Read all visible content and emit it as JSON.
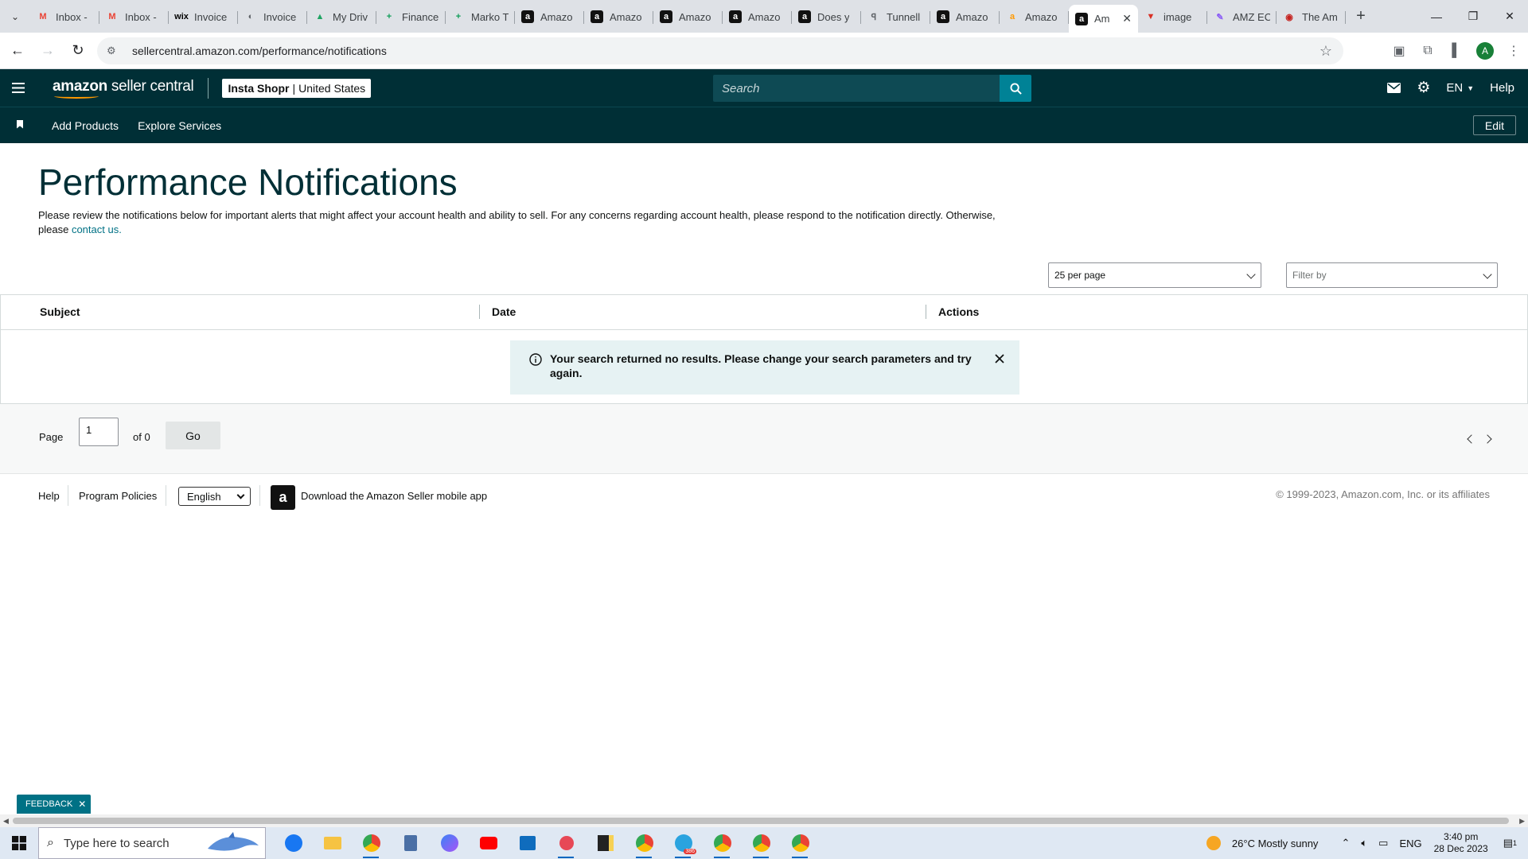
{
  "browser": {
    "tabs": [
      {
        "label": "Inbox -",
        "icon": "gmail-icon",
        "color": "#ea4335",
        "glyph": "M"
      },
      {
        "label": "Inbox -",
        "icon": "gmail-icon",
        "color": "#ea4335",
        "glyph": "M"
      },
      {
        "label": "Invoice",
        "icon": "wix-icon",
        "color": "#000000",
        "glyph": "wix"
      },
      {
        "label": "Invoice",
        "icon": "globe-icon",
        "color": "#5f6368",
        "glyph": "◐"
      },
      {
        "label": "My Driv",
        "icon": "drive-icon",
        "color": "#1fa463",
        "glyph": "▲"
      },
      {
        "label": "Finance",
        "icon": "sheets-icon",
        "color": "#0f9d58",
        "glyph": "+"
      },
      {
        "label": "Marko T",
        "icon": "sheets-icon",
        "color": "#0f9d58",
        "glyph": "+"
      },
      {
        "label": "Amazo",
        "icon": "amazon-icon",
        "color": "#111111",
        "glyph": "a"
      },
      {
        "label": "Amazo",
        "icon": "amazon-icon",
        "color": "#111111",
        "glyph": "a"
      },
      {
        "label": "Amazo",
        "icon": "amazon-icon",
        "color": "#111111",
        "glyph": "a"
      },
      {
        "label": "Amazo",
        "icon": "amazon-icon",
        "color": "#111111",
        "glyph": "a"
      },
      {
        "label": "Does y",
        "icon": "amazon-icon",
        "color": "#111111",
        "glyph": "a"
      },
      {
        "label": "Tunnell",
        "icon": "tunnel-icon",
        "color": "#5f6368",
        "glyph": "ꟼ"
      },
      {
        "label": "Amazo",
        "icon": "amazon-icon",
        "color": "#111111",
        "glyph": "a"
      },
      {
        "label": "Amazo",
        "icon": "amazon-smile-icon",
        "color": "#ff9900",
        "glyph": "a"
      }
    ],
    "active_tab": {
      "label": "Am",
      "icon": "amazon-icon",
      "color": "#111111",
      "glyph": "a"
    },
    "tabs_after": [
      {
        "label": "image",
        "icon": "vivaldi-icon",
        "color": "#d93025",
        "glyph": "▼"
      },
      {
        "label": "AMZ EC",
        "icon": "pen-icon",
        "color": "#8b5cf6",
        "glyph": "✎"
      },
      {
        "label": "The Am",
        "icon": "site-icon",
        "color": "#c5221f",
        "glyph": "◉"
      }
    ],
    "url": "sellercentral.amazon.com/performance/notifications"
  },
  "header": {
    "logo_bold": "amazon",
    "logo_rest": " seller central",
    "store_name": "Insta Shopr",
    "store_region": "United States",
    "search_placeholder": "Search",
    "language": "EN",
    "help": "Help",
    "nav_links": [
      "Add Products",
      "Explore Services"
    ],
    "edit": "Edit"
  },
  "main": {
    "title": "Performance Notifications",
    "description": "Please review the notifications below for important alerts that might affect your account health and ability to sell. For any concerns regarding account health, please respond to the notification directly. Otherwise, please",
    "contact_link": "contact us.",
    "per_page": "25 per page",
    "filter": "Filter by",
    "columns": [
      "Subject",
      "Date",
      "Actions"
    ],
    "alert": "Your search returned no results. Please change your search parameters and try again.",
    "pager": {
      "page_label": "Page",
      "page_value": "1",
      "of_label": "of 0",
      "go": "Go"
    }
  },
  "footer": {
    "help": "Help",
    "program_policies": "Program Policies",
    "language": "English",
    "app_link": "Download the Amazon Seller mobile app",
    "copyright": "© 1999-2023, Amazon.com, Inc. or its affiliates"
  },
  "feedback": "FEEDBACK",
  "taskbar": {
    "search_placeholder": "Type here to search",
    "weather": "26°C  Mostly sunny",
    "lang": "ENG",
    "time": "3:40 pm",
    "date": "28 Dec 2023",
    "notif_count": "1",
    "telegram_badge": "386"
  },
  "colors": {
    "brand_dark": "#002f36",
    "accent": "#008296",
    "link": "#007185",
    "alert_bg": "#e6f2f3"
  }
}
